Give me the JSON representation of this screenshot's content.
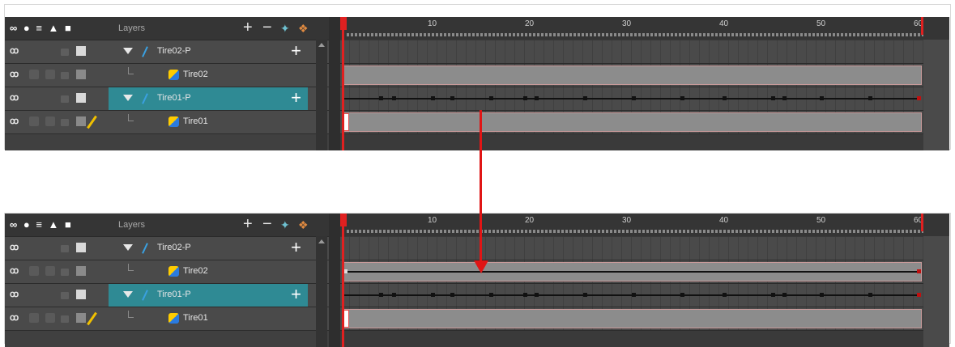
{
  "header": {
    "layers_label": "Layers",
    "icons": "◉◎≡■▢"
  },
  "ruler": {
    "ticks": [
      "10",
      "20",
      "30",
      "40",
      "50",
      "60"
    ]
  },
  "panels": [
    {
      "layers": [
        {
          "name": "Tire02-P",
          "type": "peg"
        },
        {
          "name": "Tire02",
          "type": "drawing"
        },
        {
          "name": "Tire01-P",
          "type": "peg",
          "selected": true
        },
        {
          "name": "Tire01",
          "type": "drawing"
        }
      ]
    },
    {
      "layers": [
        {
          "name": "Tire02-P",
          "type": "peg"
        },
        {
          "name": "Tire02",
          "type": "drawing"
        },
        {
          "name": "Tire01-P",
          "type": "peg",
          "selected": true
        },
        {
          "name": "Tire01",
          "type": "drawing"
        }
      ]
    }
  ],
  "colors": {
    "selected": "#2f8a94",
    "playhead": "#e02020",
    "arrow": "#e01515"
  }
}
